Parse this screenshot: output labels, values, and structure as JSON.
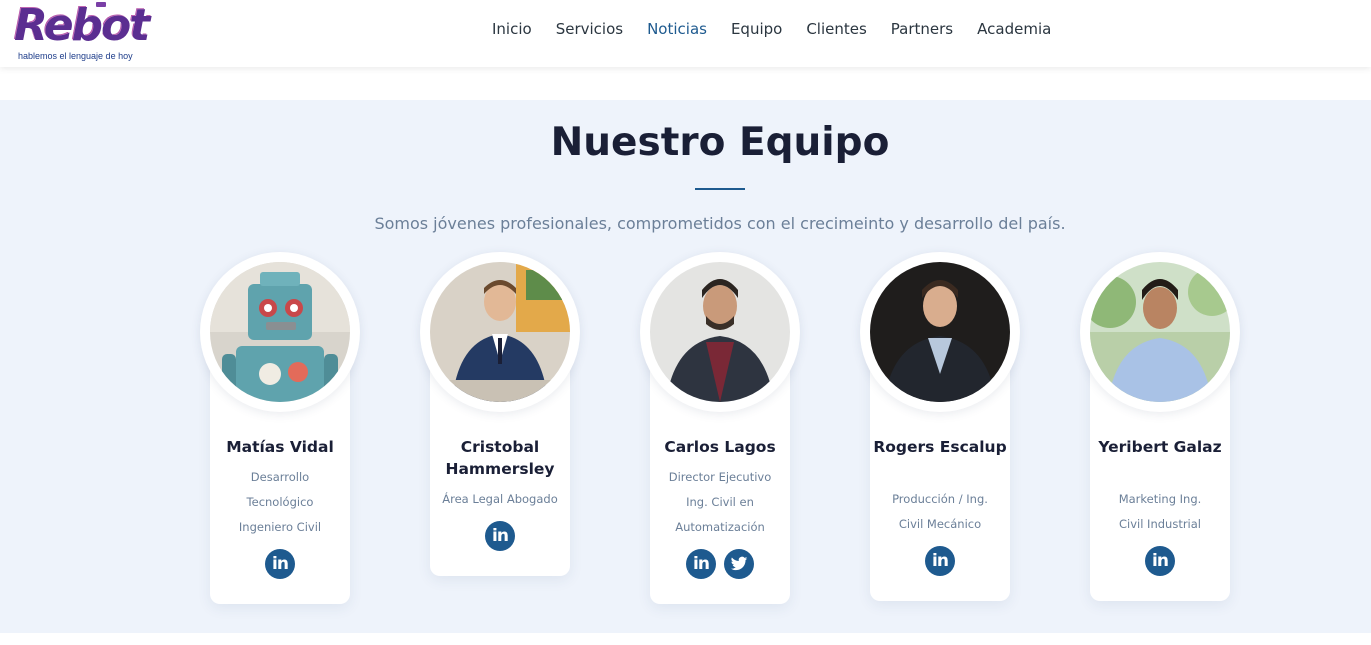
{
  "header": {
    "logo_text": "Rebot",
    "logo_tagline": "hablemos el lenguaje de hoy",
    "nav": [
      "Inicio",
      "Servicios",
      "Noticias",
      "Equipo",
      "Clientes",
      "Partners",
      "Academia"
    ],
    "active_nav": "Noticias"
  },
  "team": {
    "title": "Nuestro Equipo",
    "subtitle": "Somos jóvenes profesionales, comprometidos con el crecimeinto y desarrollo del país.",
    "members": [
      {
        "name": "Matías Vidal",
        "role_lines": [
          "Desarrollo",
          "Tecnológico",
          "Ingeniero Civil"
        ],
        "socials": [
          "linkedin-icon"
        ],
        "photo": "robot-toy"
      },
      {
        "name": "Cristobal Hammersley",
        "role_lines": [
          "Área Legal Abogado"
        ],
        "socials": [
          "linkedin-icon"
        ],
        "photo": "man-suit-office"
      },
      {
        "name": "Carlos Lagos",
        "role_lines": [
          "Director Ejecutivo",
          "Ing. Civil en",
          "Automatización"
        ],
        "socials": [
          "linkedin-icon",
          "twitter-icon"
        ],
        "photo": "man-beard-jacket"
      },
      {
        "name": "Rogers Escalup",
        "role_lines": [
          "Producción / Ing.",
          "Civil Mecánico"
        ],
        "socials": [
          "linkedin-icon"
        ],
        "photo": "man-dark-suit"
      },
      {
        "name": "Yeribert Galaz",
        "role_lines": [
          "Marketing Ing.",
          "Civil Industrial"
        ],
        "socials": [
          "linkedin-icon"
        ],
        "photo": "man-smiling-outdoor"
      }
    ]
  },
  "colors": {
    "accent": "#1e5a8f",
    "section_bg": "#eef3fb",
    "heading": "#1a1f36",
    "muted": "#6b7f98"
  }
}
